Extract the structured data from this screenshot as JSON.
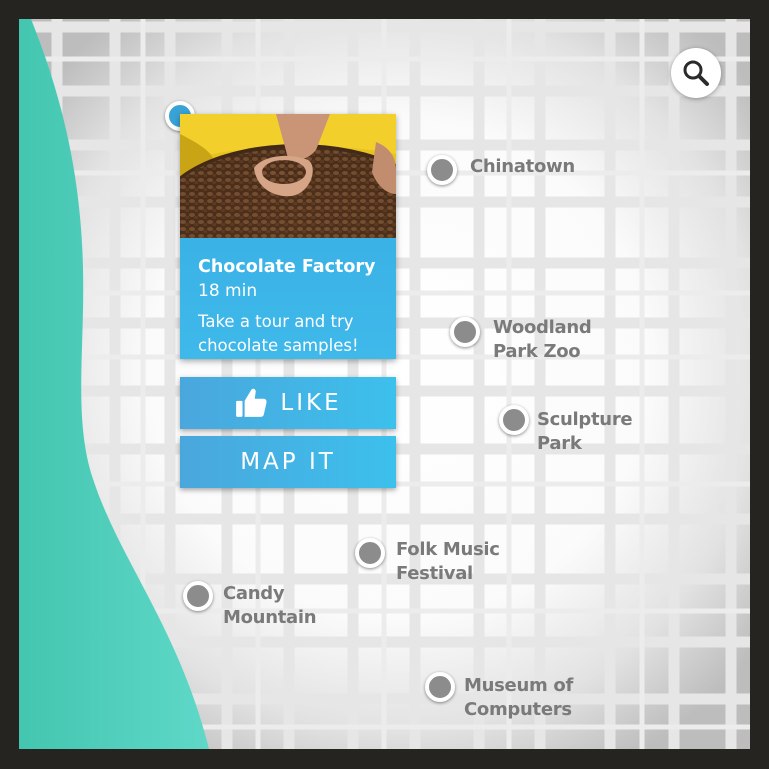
{
  "app": {
    "accent_color": "#3fb8ea",
    "sidebar_color": "#5fd6c7",
    "pin_color": "#8c8c8c",
    "label_color": "#7a7a7a"
  },
  "search": {
    "icon": "search-icon"
  },
  "selected_place": {
    "photo": "cocoa-beans-photo",
    "title": "Chocolate Factory",
    "duration": "18 min",
    "description": "Take a tour and try chocolate samples!",
    "like_label": "LIKE",
    "like_icon": "thumbs-up-icon",
    "map_label": "MAP IT"
  },
  "places": {
    "chinatown": {
      "line1": "Chinatown",
      "line2": ""
    },
    "woodland_park_zoo": {
      "line1": "Woodland",
      "line2": "Park Zoo"
    },
    "sculpture_park": {
      "line1": "Sculpture",
      "line2": "Park"
    },
    "folk_music_festival": {
      "line1": "Folk Music",
      "line2": "Festival"
    },
    "candy_mountain": {
      "line1": "Candy",
      "line2": "Mountain"
    },
    "museum_of_computers": {
      "line1": "Museum of",
      "line2": "Computers"
    }
  }
}
